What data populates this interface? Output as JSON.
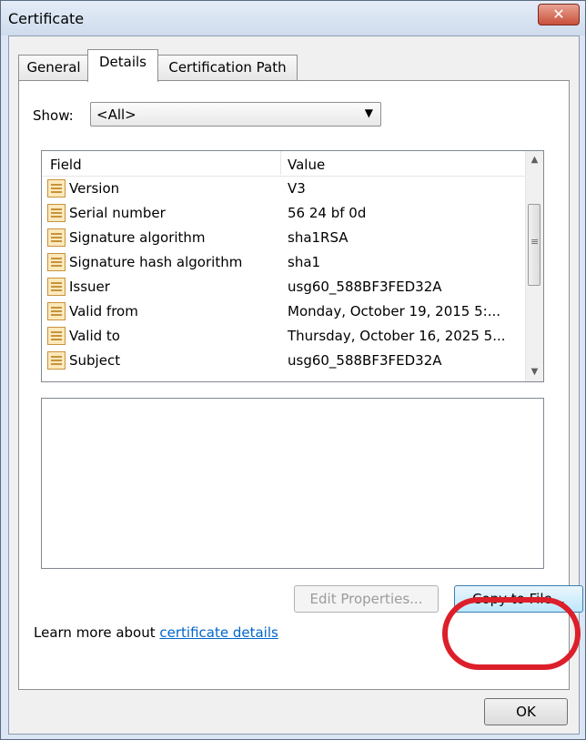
{
  "window": {
    "title": "Certificate",
    "close_glyph": "✕"
  },
  "tabs": [
    {
      "label": "General"
    },
    {
      "label": "Details"
    },
    {
      "label": "Certification Path"
    }
  ],
  "show": {
    "label": "Show:",
    "value": "<All>",
    "arrow": "▼"
  },
  "list": {
    "headers": {
      "field": "Field",
      "value": "Value"
    },
    "rows": [
      {
        "field": "Version",
        "value": "V3"
      },
      {
        "field": "Serial number",
        "value": "56 24 bf 0d"
      },
      {
        "field": "Signature algorithm",
        "value": "sha1RSA"
      },
      {
        "field": "Signature hash algorithm",
        "value": "sha1"
      },
      {
        "field": "Issuer",
        "value": "usg60_588BF3FED32A"
      },
      {
        "field": "Valid from",
        "value": "Monday, October 19, 2015 5:..."
      },
      {
        "field": "Valid to",
        "value": "Thursday, October 16, 2025 5..."
      },
      {
        "field": "Subject",
        "value": "usg60_588BF3FED32A"
      }
    ],
    "row_icon": "certificate-field-icon",
    "scroll_up": "▲",
    "scroll_down": "▼"
  },
  "buttons": {
    "edit_properties": "Edit Properties...",
    "copy_to_file": "Copy to File...",
    "ok": "OK"
  },
  "learn": {
    "prefix": "Learn more about ",
    "link": "certificate details"
  },
  "colors": {
    "highlight": "#dc1f2a",
    "link": "#0066cc",
    "close": "#c8503a"
  }
}
